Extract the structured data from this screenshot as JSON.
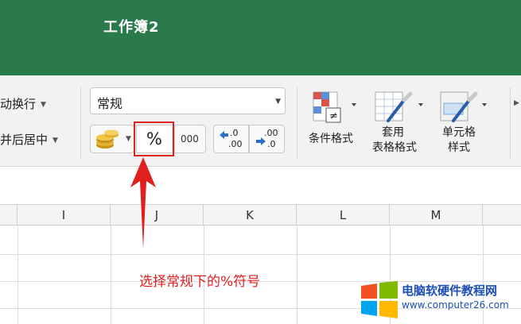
{
  "window": {
    "title": "工作簿2"
  },
  "ribbon": {
    "wrap_text_label": "动换行",
    "merge_center_label": "并后居中",
    "number_format": {
      "value": "常规"
    },
    "percent_label": "%",
    "comma_label": "000",
    "increase_decimal_top": ".0",
    "increase_decimal_bottom": ".00",
    "decrease_decimal_top": ".00",
    "decrease_decimal_bottom": ".0",
    "conditional_format_label": "条件格式",
    "table_format_label_1": "套用",
    "table_format_label_2": "表格格式",
    "cell_styles_label_1": "单元格",
    "cell_styles_label_2": "样式"
  },
  "sheet": {
    "columns": [
      "I",
      "J",
      "K",
      "L",
      "M"
    ]
  },
  "annotation": {
    "text": "选择常规下的%符号",
    "color": "#e01f1f"
  },
  "watermark": {
    "name": "电脑软硬件教程网",
    "url": "www.computer26.com"
  },
  "colors": {
    "titlebar": "#2a7a4b",
    "highlight": "#d9251f"
  }
}
